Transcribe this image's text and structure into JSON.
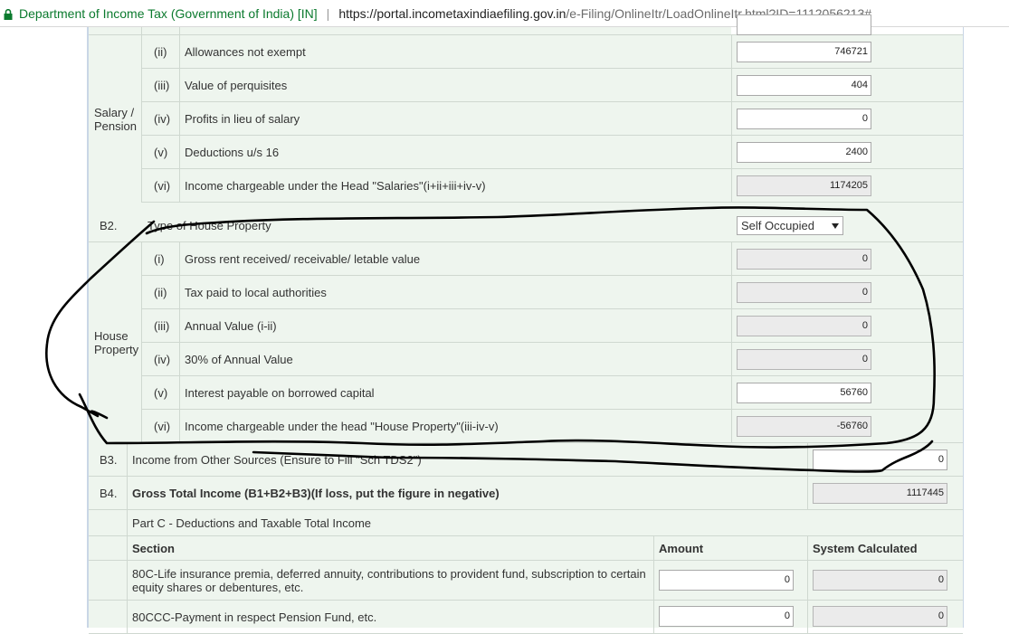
{
  "browser": {
    "site_identity": "Department of Income Tax (Government of India) [IN]",
    "separator": "|",
    "url_host": "https://portal.incometaxindiaefiling.gov.in",
    "url_path": "/e-Filing/OnlineItr/LoadOnlineItr.html?ID=1112056213#"
  },
  "salary": {
    "group_label": "Salary / Pension",
    "rows": [
      {
        "num": "(ii)",
        "label": "Allowances not exempt",
        "value": "746721",
        "readonly": false
      },
      {
        "num": "(iii)",
        "label": "Value of perquisites",
        "value": "404",
        "readonly": false
      },
      {
        "num": "(iv)",
        "label": "Profits in lieu of salary",
        "value": "0",
        "readonly": false
      },
      {
        "num": "(v)",
        "label": "Deductions u/s 16",
        "value": "2400",
        "readonly": false
      },
      {
        "num": "(vi)",
        "label": "Income chargeable under the Head \"Salaries\"(i+ii+iii+iv-v)",
        "value": "1174205",
        "readonly": true
      }
    ]
  },
  "b2": {
    "code": "B2.",
    "label": "Type of House Property",
    "selected": "Self Occupied"
  },
  "house": {
    "group_label": "House Property",
    "rows": [
      {
        "num": "(i)",
        "label": "Gross rent received/ receivable/ letable value",
        "value": "0",
        "readonly": true
      },
      {
        "num": "(ii)",
        "label": "Tax paid to local authorities",
        "value": "0",
        "readonly": true
      },
      {
        "num": "(iii)",
        "label": "Annual Value (i-ii)",
        "value": "0",
        "readonly": true
      },
      {
        "num": "(iv)",
        "label": "30% of Annual Value",
        "value": "0",
        "readonly": true
      },
      {
        "num": "(v)",
        "label": "Interest payable on borrowed capital",
        "value": "56760",
        "readonly": false
      },
      {
        "num": "(vi)",
        "label": "Income chargeable under the head \"House Property\"(iii-iv-v)",
        "value": "-56760",
        "readonly": true
      }
    ]
  },
  "b3": {
    "code": "B3.",
    "label": "Income from Other Sources (Ensure to Fill \"Sch TDS2\")",
    "value": "0"
  },
  "b4": {
    "code": "B4.",
    "label": "Gross Total Income (B1+B2+B3)(If loss, put the figure in negative)",
    "value": "1117445"
  },
  "part_c": {
    "title": "Part C - Deductions and Taxable Total Income",
    "headers": {
      "section": "Section",
      "amount": "Amount",
      "system": "System Calculated"
    },
    "rows": [
      {
        "label": "80C-Life insurance premia, deferred annuity, contributions to provident fund, subscription to certain equity shares or debentures, etc.",
        "amount": "0",
        "system": "0"
      },
      {
        "label": "80CCC-Payment in respect Pension Fund, etc.",
        "amount": "0",
        "system": "0"
      }
    ]
  },
  "colors": {
    "panel_bg": "#eef5ee",
    "site_identity": "#0b7a2e",
    "readonly_bg": "#ebebeb"
  },
  "icons": [
    "lock-icon",
    "dropdown-arrow-icon"
  ]
}
